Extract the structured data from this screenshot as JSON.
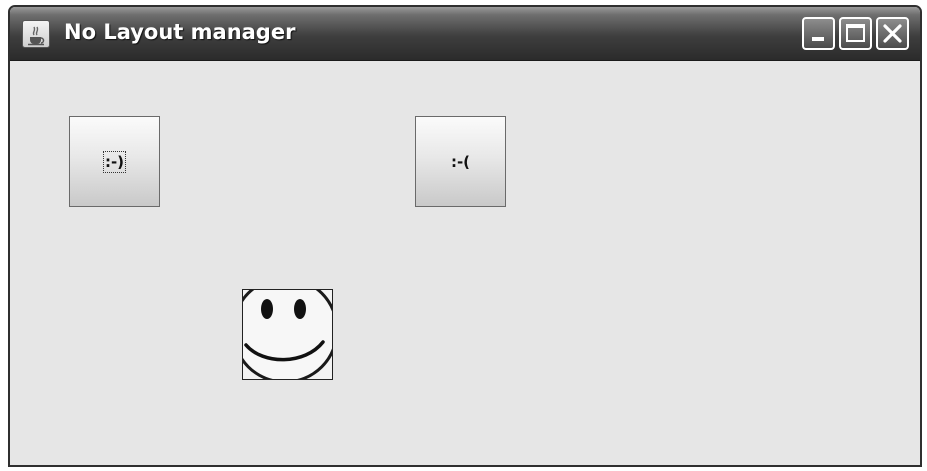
{
  "window": {
    "title": "No Layout manager",
    "app_icon": "java-coffee-cup-icon",
    "controls": {
      "minimize_icon": "minimize-icon",
      "maximize_icon": "maximize-icon",
      "close_icon": "close-icon"
    }
  },
  "buttons": [
    {
      "label": ":-)",
      "focused": true
    },
    {
      "label": ":-(",
      "focused": false
    }
  ],
  "image": {
    "icon": "smiley-face-icon"
  },
  "colors": {
    "titlebar": "#3e3e3e",
    "content_background": "#e6e6e6",
    "title_text": "#ffffff"
  }
}
